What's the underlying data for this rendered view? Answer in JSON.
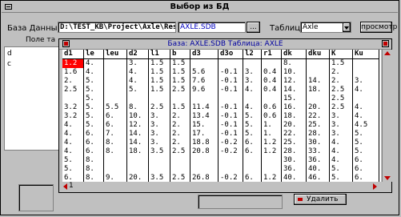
{
  "window": {
    "title": "Выбор из БД"
  },
  "db": {
    "label": "База Данных:",
    "path": "D:\\TEST_KB\\Project\\Axle\\Res",
    "browse_label": "...",
    "selected_db": "AXLE.SDB"
  },
  "table_select": {
    "label": "Таблица:",
    "value": "Axle"
  },
  "view_button": "просмотр",
  "left_panel": {
    "header": "Поле та",
    "items": [
      "d",
      "c"
    ]
  },
  "grid": {
    "title": "База: AXLE.SDB Таблица: AXLE",
    "columns": [
      "d1",
      "le",
      "leu",
      "d2",
      "l1",
      "b",
      "d3",
      "d3o",
      "l2",
      "r1",
      "dk",
      "dku",
      "K",
      "Ku"
    ],
    "rows": [
      [
        "1.2",
        "4.",
        "",
        "3.",
        "1.5",
        "1.5",
        "",
        "",
        "",
        "",
        "8.",
        "",
        "1.5",
        ""
      ],
      [
        "1.6",
        "4.",
        "",
        "4.",
        "1.5",
        "1.5",
        "5.6",
        "-0.1",
        "3.",
        "0.4",
        "10.",
        "",
        "2.",
        ""
      ],
      [
        "2.",
        "5.",
        "",
        "4.",
        "1.5",
        "1.5",
        "7.6",
        "-0.1",
        "3.",
        "0.4",
        "12.",
        "14.",
        "2.",
        "3."
      ],
      [
        "2.5",
        "5.",
        "",
        "5.",
        "1.5",
        "2.5",
        "9.6",
        "-0.1",
        "4.",
        "0.4",
        "14.",
        "18.",
        "2.5",
        "4."
      ],
      [
        "",
        "5.",
        "",
        "",
        "",
        "",
        "",
        "",
        "",
        "",
        "15.",
        "",
        "2.5",
        ""
      ],
      [
        "3.2",
        "5.",
        "5.5",
        "8.",
        "2.5",
        "1.5",
        "11.4",
        "-0.1",
        "4.",
        "0.6",
        "16.",
        "20.",
        "2.5",
        "4."
      ],
      [
        "3.2",
        "5.",
        "6.",
        "10.",
        "3.",
        "2.",
        "13.4",
        "-0.1",
        "5.",
        "0.6",
        "18.",
        "22.",
        "3.",
        "4."
      ],
      [
        "4.",
        "5.",
        "6.",
        "12.",
        "3.",
        "2.",
        "15.",
        "-0.1",
        "5.",
        "1.",
        "20.",
        "25.",
        "3.",
        "4.5"
      ],
      [
        "4.",
        "6.",
        "7.",
        "14.",
        "3.",
        "2.",
        "17.",
        "-0.1",
        "5.",
        "1.",
        "22.",
        "28.",
        "3.",
        "5."
      ],
      [
        "4.",
        "6.",
        "8.",
        "14.",
        "3.",
        "2.",
        "18.8",
        "-0.2",
        "6.",
        "1.2",
        "25.",
        "30.",
        "4.",
        "5."
      ],
      [
        "4.",
        "6.",
        "8.",
        "18.",
        "3.5",
        "2.5",
        "20.8",
        "-0.2",
        "6.",
        "1.2",
        "28.",
        "33.",
        "4.",
        "5."
      ],
      [
        "5.",
        "8.",
        "",
        "",
        "",
        "",
        "",
        "",
        "",
        "",
        "30.",
        "36.",
        "4.",
        "6."
      ],
      [
        "5.",
        "8.",
        "",
        "",
        "",
        "",
        "",
        "",
        "",
        "",
        "36.",
        "40.",
        "5.",
        "6."
      ],
      [
        "6.",
        "8.",
        "9.",
        "20.",
        "3.5",
        "2.5",
        "26.8",
        "-0.2",
        "6.",
        "1.2",
        "40.",
        "46.",
        "5.",
        "6."
      ]
    ]
  },
  "scroll_position": "1",
  "delete_button": "Удалить"
}
